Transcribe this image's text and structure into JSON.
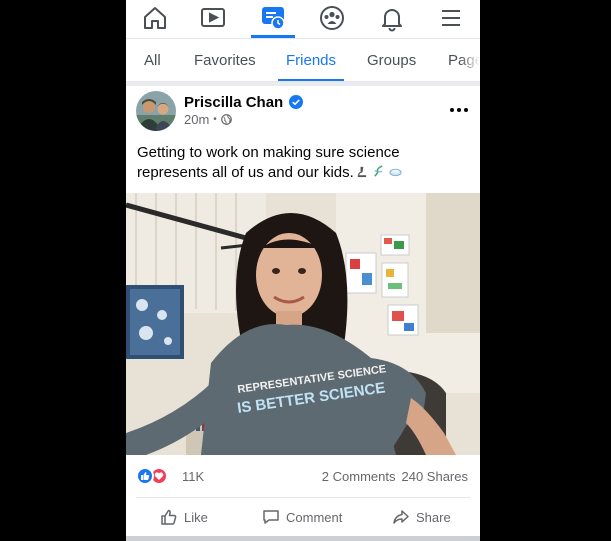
{
  "top_nav": {
    "items": [
      {
        "icon": "home-icon"
      },
      {
        "icon": "video-icon"
      },
      {
        "icon": "feeds-icon",
        "active": true
      },
      {
        "icon": "groups-icon"
      },
      {
        "icon": "bell-icon"
      },
      {
        "icon": "menu-icon"
      }
    ]
  },
  "feed_tabs": [
    "All",
    "Favorites",
    "Friends",
    "Groups",
    "Pages"
  ],
  "active_tab": "Friends",
  "post": {
    "author": "Priscilla Chan",
    "time": "20m",
    "audience_icon": "globe-icon",
    "text_line1": "Getting to work on making sure science",
    "text_line2": "represents all of us and our kids.",
    "emoji": [
      "microscope-emoji",
      "dna-emoji",
      "petri-dish-emoji"
    ],
    "shirt_text": [
      "REPRESENTATIVE SCIENCE",
      "IS BETTER SCIENCE"
    ],
    "reaction_count": "11K",
    "comments": "2 Comments",
    "shares": "240 Shares"
  },
  "actions": {
    "like": "Like",
    "comment": "Comment",
    "share": "Share"
  },
  "colors": {
    "accent": "#1877f2",
    "love": "#f33e58",
    "muted_text": "#65676b"
  }
}
